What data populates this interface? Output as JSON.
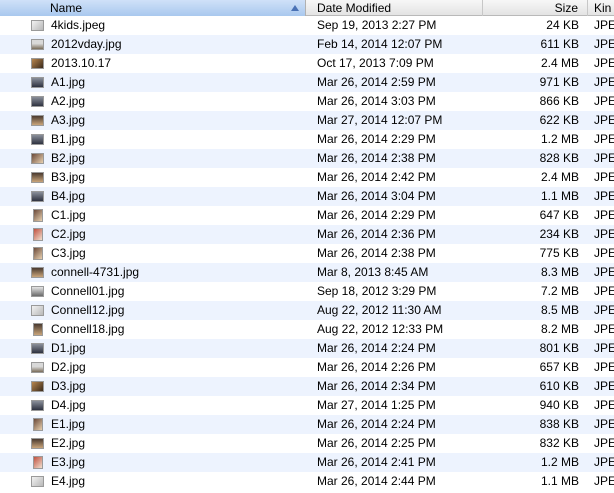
{
  "columns": {
    "name": "Name",
    "date_modified": "Date Modified",
    "size": "Size",
    "kind": "Kin"
  },
  "sort": {
    "column": "Name",
    "direction": "ascending"
  },
  "files": [
    {
      "name": "4kids.jpeg",
      "date": "Sep 19, 2013 2:27 PM",
      "size": "24 KB",
      "kind": "JPE",
      "thumb": "t1"
    },
    {
      "name": "2012vday.jpg",
      "date": "Feb 14, 2014 12:07 PM",
      "size": "611 KB",
      "kind": "JPE",
      "thumb": "t2"
    },
    {
      "name": "2013.10.17",
      "date": "Oct 17, 2013 7:09 PM",
      "size": "2.4 MB",
      "kind": "JPE",
      "thumb": "t3"
    },
    {
      "name": "A1.jpg",
      "date": "Mar 26, 2014 2:59 PM",
      "size": "971 KB",
      "kind": "JPE",
      "thumb": "t4"
    },
    {
      "name": "A2.jpg",
      "date": "Mar 26, 2014 3:03 PM",
      "size": "866 KB",
      "kind": "JPE",
      "thumb": "t4"
    },
    {
      "name": "A3.jpg",
      "date": "Mar 27, 2014 12:07 PM",
      "size": "622 KB",
      "kind": "JPE",
      "thumb": "t6"
    },
    {
      "name": "B1.jpg",
      "date": "Mar 26, 2014 2:29 PM",
      "size": "1.2 MB",
      "kind": "JPE",
      "thumb": "t4"
    },
    {
      "name": "B2.jpg",
      "date": "Mar 26, 2014 2:38 PM",
      "size": "828 KB",
      "kind": "JPE",
      "thumb": "t5"
    },
    {
      "name": "B3.jpg",
      "date": "Mar 26, 2014 2:42 PM",
      "size": "2.4 MB",
      "kind": "JPE",
      "thumb": "t6"
    },
    {
      "name": "B4.jpg",
      "date": "Mar 26, 2014 3:04 PM",
      "size": "1.1 MB",
      "kind": "JPE",
      "thumb": "t4"
    },
    {
      "name": "C1.jpg",
      "date": "Mar 26, 2014 2:29 PM",
      "size": "647 KB",
      "kind": "JPE",
      "thumb": "t5",
      "tall": true
    },
    {
      "name": "C2.jpg",
      "date": "Mar 26, 2014 2:36 PM",
      "size": "234 KB",
      "kind": "JPE",
      "thumb": "t7",
      "tall": true
    },
    {
      "name": "C3.jpg",
      "date": "Mar 26, 2014 2:38 PM",
      "size": "775 KB",
      "kind": "JPE",
      "thumb": "t5",
      "tall": true
    },
    {
      "name": "connell-4731.jpg",
      "date": "Mar 8, 2013 8:45 AM",
      "size": "8.3 MB",
      "kind": "JPE",
      "thumb": "t6"
    },
    {
      "name": "Connell01.jpg",
      "date": "Sep 18, 2012 3:29 PM",
      "size": "7.2 MB",
      "kind": "JPE",
      "thumb": "t8"
    },
    {
      "name": "Connell12.jpg",
      "date": "Aug 22, 2012 11:30 AM",
      "size": "8.5 MB",
      "kind": "JPE",
      "thumb": "t1"
    },
    {
      "name": "Connell18.jpg",
      "date": "Aug 22, 2012 12:33 PM",
      "size": "8.2 MB",
      "kind": "JPE",
      "thumb": "t6",
      "tall": true
    },
    {
      "name": "D1.jpg",
      "date": "Mar 26, 2014 2:24 PM",
      "size": "801 KB",
      "kind": "JPE",
      "thumb": "t4"
    },
    {
      "name": "D2.jpg",
      "date": "Mar 26, 2014 2:26 PM",
      "size": "657 KB",
      "kind": "JPE",
      "thumb": "t2"
    },
    {
      "name": "D3.jpg",
      "date": "Mar 26, 2014 2:34 PM",
      "size": "610 KB",
      "kind": "JPE",
      "thumb": "t3"
    },
    {
      "name": "D4.jpg",
      "date": "Mar 27, 2014 1:25 PM",
      "size": "940 KB",
      "kind": "JPE",
      "thumb": "t4"
    },
    {
      "name": "E1.jpg",
      "date": "Mar 26, 2014 2:24 PM",
      "size": "838 KB",
      "kind": "JPE",
      "thumb": "t5",
      "tall": true
    },
    {
      "name": "E2.jpg",
      "date": "Mar 26, 2014 2:25 PM",
      "size": "832 KB",
      "kind": "JPE",
      "thumb": "t6"
    },
    {
      "name": "E3.jpg",
      "date": "Mar 26, 2014 2:41 PM",
      "size": "1.2 MB",
      "kind": "JPE",
      "thumb": "t7",
      "tall": true
    },
    {
      "name": "E4.jpg",
      "date": "Mar 26, 2014 2:44 PM",
      "size": "1.1 MB",
      "kind": "JPE",
      "thumb": "t1"
    }
  ]
}
